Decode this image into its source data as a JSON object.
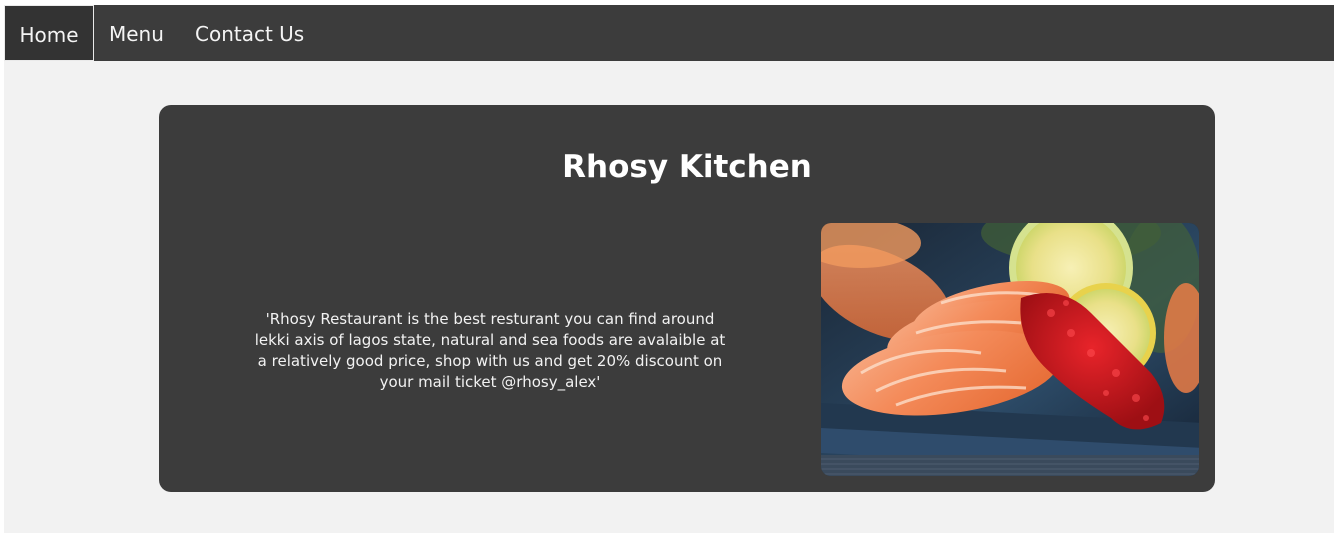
{
  "nav": {
    "items": [
      {
        "label": "Home",
        "active": true
      },
      {
        "label": "Menu",
        "active": false
      },
      {
        "label": "Contact Us",
        "active": false
      }
    ]
  },
  "hero": {
    "title": "Rhosy Kitchen",
    "description": "'Rhosy Restaurant is the best resturant you can find around lekki axis of lagos state, natural and sea foods are avalaible at a relatively good price, shop with us and get 20% discount on your mail ticket @rhosy_alex'",
    "image_subject": "salmon-sushi"
  },
  "colors": {
    "navbar": "#3c3c3c",
    "card": "#3c3c3c",
    "page_background": "#f2f2f2",
    "text": "#ffffff"
  }
}
